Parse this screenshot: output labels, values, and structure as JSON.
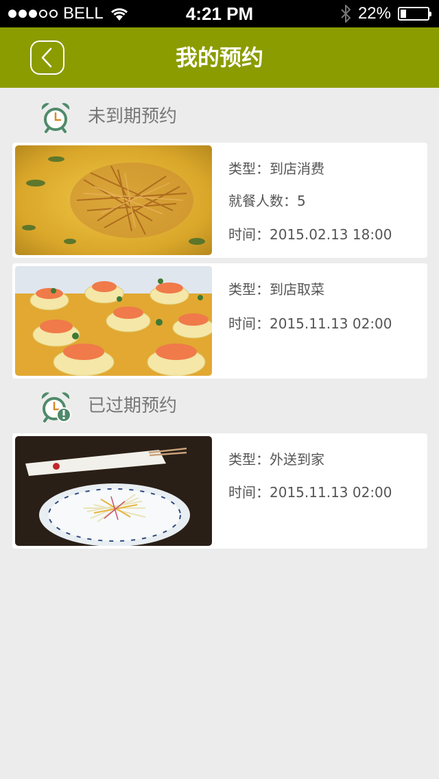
{
  "status_bar": {
    "carrier": "BELL",
    "time": "4:21 PM",
    "battery_percent_text": "22%",
    "battery_level": 0.22,
    "signal_bars_filled": 3,
    "signal_bars_total": 5
  },
  "header": {
    "title": "我的预约",
    "back_icon": "chevron-left-icon"
  },
  "sections": [
    {
      "title": "未到期预约",
      "icon": "alarm-clock-icon",
      "cards": [
        {
          "image_desc": "food-photo-soup",
          "lines": [
            {
              "label": "类型：",
              "value": "到店消费"
            },
            {
              "label": "就餐人数：",
              "value": "5"
            },
            {
              "label": "时间：",
              "value": "2015.02.13 18:00"
            }
          ]
        },
        {
          "image_desc": "food-photo-shrimp",
          "lines": [
            {
              "label": "类型：",
              "value": "到店取菜"
            },
            {
              "label": "时间：",
              "value": "2015.11.13 02:00"
            }
          ]
        }
      ]
    },
    {
      "title": "已过期预约",
      "icon": "alarm-clock-expired-icon",
      "cards": [
        {
          "image_desc": "food-photo-salad",
          "lines": [
            {
              "label": "类型：",
              "value": "外送到家"
            },
            {
              "label": "时间：",
              "value": "2015.11.13 02:00"
            }
          ]
        }
      ]
    }
  ],
  "colors": {
    "accent": "#8b9c00",
    "icon_green": "#4f8a6a",
    "background": "#ececec"
  }
}
